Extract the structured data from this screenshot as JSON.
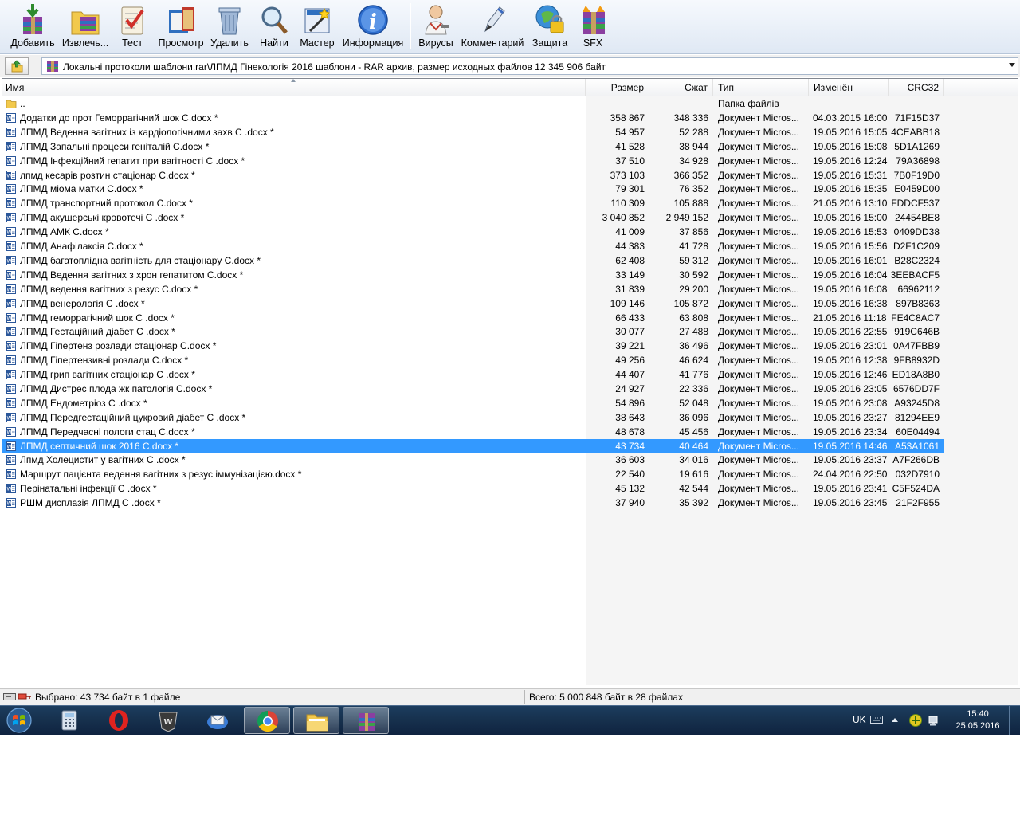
{
  "toolbar": {
    "buttons": [
      {
        "id": "add",
        "label": "Добавить",
        "icon": "add-archive-icon"
      },
      {
        "id": "extract",
        "label": "Извлечь...",
        "icon": "extract-folder-icon"
      },
      {
        "id": "test",
        "label": "Тест",
        "icon": "test-checklist-icon"
      },
      {
        "id": "view",
        "label": "Просмотр",
        "icon": "view-book-icon"
      },
      {
        "id": "delete",
        "label": "Удалить",
        "icon": "delete-trash-icon"
      },
      {
        "id": "find",
        "label": "Найти",
        "icon": "find-magnifier-icon"
      },
      {
        "id": "wizard",
        "label": "Мастер",
        "icon": "wizard-icon"
      },
      {
        "id": "info",
        "label": "Информация",
        "icon": "info-icon"
      },
      {
        "id": "virus",
        "label": "Вирусы",
        "icon": "virus-scan-icon"
      },
      {
        "id": "comment",
        "label": "Комментарий",
        "icon": "comment-pen-icon"
      },
      {
        "id": "protect",
        "label": "Защита",
        "icon": "protect-lock-icon"
      },
      {
        "id": "sfx",
        "label": "SFX",
        "icon": "sfx-archive-icon"
      }
    ]
  },
  "address": {
    "path": "Локальні протоколи шаблони.rar\\ЛПМД Гінекологія 2016  шаблони - RAR архив, размер исходных файлов 12 345 906 байт"
  },
  "columns": {
    "name": "Имя",
    "size": "Размер",
    "packed": "Сжат",
    "type": "Тип",
    "modified": "Изменён",
    "crc": "CRC32"
  },
  "files": [
    {
      "name": "..",
      "size": "",
      "packed": "",
      "type": "Папка файлів",
      "modified": "",
      "crc": "",
      "kind": "folder"
    },
    {
      "name": "Додатки до прот Геморрагічний шок С.docx *",
      "size": "358 867",
      "packed": "348 336",
      "type": "Документ Micros...",
      "modified": "04.03.2015 16:00",
      "crc": "71F15D37",
      "kind": "doc"
    },
    {
      "name": "ЛПМД  Ведення вагітних  із кардіологічними захв С .docx *",
      "size": "54 957",
      "packed": "52 288",
      "type": "Документ Micros...",
      "modified": "19.05.2016 15:05",
      "crc": "4CEABB18",
      "kind": "doc"
    },
    {
      "name": "ЛПМД  Запальні процеси геніталій С.docx *",
      "size": "41 528",
      "packed": "38 944",
      "type": "Документ Micros...",
      "modified": "19.05.2016 15:08",
      "crc": "5D1A1269",
      "kind": "doc"
    },
    {
      "name": "ЛПМД  Інфекційний гепатит при вагітності  С .docx *",
      "size": "37 510",
      "packed": "34 928",
      "type": "Документ Micros...",
      "modified": "19.05.2016 12:24",
      "crc": "79A36898",
      "kind": "doc"
    },
    {
      "name": "лпмд  кесарів розтин стаціонар С.docx *",
      "size": "373 103",
      "packed": "366 352",
      "type": "Документ Micros...",
      "modified": "19.05.2016 15:31",
      "crc": "7B0F19D0",
      "kind": "doc"
    },
    {
      "name": "ЛПМД  міома матки   С.docx *",
      "size": "79 301",
      "packed": "76 352",
      "type": "Документ Micros...",
      "modified": "19.05.2016 15:35",
      "crc": "E0459D00",
      "kind": "doc"
    },
    {
      "name": "ЛПМД  транспортний протокол С.docx *",
      "size": "110 309",
      "packed": "105 888",
      "type": "Документ Micros...",
      "modified": "21.05.2016 13:10",
      "crc": "FDDCF537",
      "kind": "doc"
    },
    {
      "name": "ЛПМД акушерські кровотечі  С .docx *",
      "size": "3 040 852",
      "packed": "2 949 152",
      "type": "Документ Micros...",
      "modified": "19.05.2016 15:00",
      "crc": "24454BE8",
      "kind": "doc"
    },
    {
      "name": "ЛПМД АМК   С.docx *",
      "size": "41 009",
      "packed": "37 856",
      "type": "Документ Micros...",
      "modified": "19.05.2016 15:53",
      "crc": "0409DD38",
      "kind": "doc"
    },
    {
      "name": "ЛПМД Анафілаксія  С.docx *",
      "size": "44 383",
      "packed": "41 728",
      "type": "Документ Micros...",
      "modified": "19.05.2016 15:56",
      "crc": "D2F1C209",
      "kind": "doc"
    },
    {
      "name": "ЛПМД багатоплідна вагітність  для стаціонару  С.docx *",
      "size": "62 408",
      "packed": "59 312",
      "type": "Документ Micros...",
      "modified": "19.05.2016 16:01",
      "crc": "B28C2324",
      "kind": "doc"
    },
    {
      "name": "ЛПМД Ведення вагітних з  хрон гепатитом  С.docx *",
      "size": "33 149",
      "packed": "30 592",
      "type": "Документ Micros...",
      "modified": "19.05.2016 16:04",
      "crc": "3EEBACF5",
      "kind": "doc"
    },
    {
      "name": "ЛПМД ведення вагітних з резус  С.docx *",
      "size": "31 839",
      "packed": "29 200",
      "type": "Документ Micros...",
      "modified": "19.05.2016 16:08",
      "crc": "66962112",
      "kind": "doc"
    },
    {
      "name": "ЛПМД венерологія С .docx *",
      "size": "109 146",
      "packed": "105 872",
      "type": "Документ Micros...",
      "modified": "19.05.2016 16:38",
      "crc": "897B8363",
      "kind": "doc"
    },
    {
      "name": "ЛПМД геморрагічний шок С .docx *",
      "size": "66 433",
      "packed": "63 808",
      "type": "Документ Micros...",
      "modified": "21.05.2016 11:18",
      "crc": "FE4C8AC7",
      "kind": "doc"
    },
    {
      "name": "ЛПМД Гестаційний діабет С .docx *",
      "size": "30 077",
      "packed": "27 488",
      "type": "Документ Micros...",
      "modified": "19.05.2016 22:55",
      "crc": "919C646B",
      "kind": "doc"
    },
    {
      "name": "ЛПМД Гіпертенз розлади  стаціонар С.docx *",
      "size": "39 221",
      "packed": "36 496",
      "type": "Документ Micros...",
      "modified": "19.05.2016 23:01",
      "crc": "0A47FBB9",
      "kind": "doc"
    },
    {
      "name": "ЛПМД Гіпертензивні розлади С.docx *",
      "size": "49 256",
      "packed": "46 624",
      "type": "Документ Micros...",
      "modified": "19.05.2016 12:38",
      "crc": "9FB8932D",
      "kind": "doc"
    },
    {
      "name": "ЛПМД грип вагітних стаціонар С .docx *",
      "size": "44 407",
      "packed": "41 776",
      "type": "Документ Micros...",
      "modified": "19.05.2016 12:46",
      "crc": "ED18A8B0",
      "kind": "doc"
    },
    {
      "name": "ЛПМД Дистрес плода жк патологія С.docx *",
      "size": "24 927",
      "packed": "22 336",
      "type": "Документ Micros...",
      "modified": "19.05.2016 23:05",
      "crc": "6576DD7F",
      "kind": "doc"
    },
    {
      "name": "ЛПМД Ендометріоз С .docx *",
      "size": "54 896",
      "packed": "52 048",
      "type": "Документ Micros...",
      "modified": "19.05.2016 23:08",
      "crc": "A93245D8",
      "kind": "doc"
    },
    {
      "name": "ЛПМД Передгестаційний цукровий діабет С .docx *",
      "size": "38 643",
      "packed": "36 096",
      "type": "Документ Micros...",
      "modified": "19.05.2016 23:27",
      "crc": "81294EE9",
      "kind": "doc"
    },
    {
      "name": "ЛПМД Передчасні  пологи стац  С.docx *",
      "size": "48 678",
      "packed": "45 456",
      "type": "Документ Micros...",
      "modified": "19.05.2016 23:34",
      "crc": "60E04494",
      "kind": "doc"
    },
    {
      "name": "ЛПМД септичний шок 2016 С.docx *",
      "size": "43 734",
      "packed": "40 464",
      "type": "Документ Micros...",
      "modified": "19.05.2016 14:46",
      "crc": "A53A1061",
      "kind": "doc",
      "selected": true
    },
    {
      "name": "Лпмд Холецистит у вагітних   С .docx *",
      "size": "36 603",
      "packed": "34 016",
      "type": "Документ Micros...",
      "modified": "19.05.2016 23:37",
      "crc": "A7F266DB",
      "kind": "doc"
    },
    {
      "name": "Маршрут пацієнта ведення вагітних з резус іммунізацією.docx *",
      "size": "22 540",
      "packed": "19 616",
      "type": "Документ Micros...",
      "modified": "24.04.2016 22:50",
      "crc": "032D7910",
      "kind": "doc"
    },
    {
      "name": "Перінатальні інфекції   С .docx *",
      "size": "45 132",
      "packed": "42 544",
      "type": "Документ Micros...",
      "modified": "19.05.2016 23:41",
      "crc": "C5F524DA",
      "kind": "doc"
    },
    {
      "name": "РШМ дисплазія ЛПМД  С  .docx *",
      "size": "37 940",
      "packed": "35 392",
      "type": "Документ Micros...",
      "modified": "19.05.2016 23:45",
      "crc": "21F2F955",
      "kind": "doc"
    }
  ],
  "status": {
    "selected": "Выбрано: 43 734 байт в 1 файле",
    "total": "Всего: 5 000 848 байт в 28 файлах"
  },
  "taskbar": {
    "apps": [
      {
        "icon": "calculator-icon",
        "active": false
      },
      {
        "icon": "opera-icon",
        "active": false
      },
      {
        "icon": "world-of-tanks-icon",
        "active": false
      },
      {
        "icon": "mail-icon",
        "active": false
      },
      {
        "icon": "chrome-icon",
        "active": true
      },
      {
        "icon": "file-explorer-icon",
        "active": true
      },
      {
        "icon": "winrar-icon",
        "active": true
      }
    ],
    "language": "UK",
    "time": "15:40",
    "date": "25.05.2016"
  },
  "colors": {
    "selection": "#3399ff",
    "taskbar": "#16304d"
  }
}
